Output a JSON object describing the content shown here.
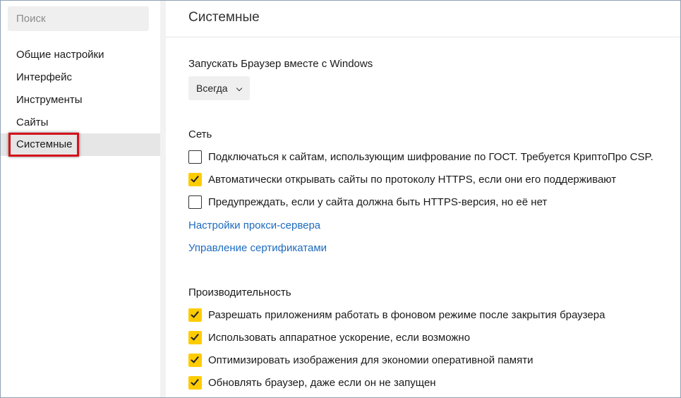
{
  "sidebar": {
    "search_placeholder": "Поиск",
    "items": [
      {
        "label": "Общие настройки"
      },
      {
        "label": "Интерфейс"
      },
      {
        "label": "Инструменты"
      },
      {
        "label": "Сайты"
      },
      {
        "label": "Системные",
        "active": true
      }
    ]
  },
  "main": {
    "title": "Системные",
    "startup": {
      "title": "Запускать Браузер вместе с Windows",
      "dropdown_value": "Всегда"
    },
    "network": {
      "title": "Сеть",
      "options": [
        {
          "label": "Подключаться к сайтам, использующим шифрование по ГОСТ. Требуется КриптоПро CSP.",
          "checked": false
        },
        {
          "label": "Автоматически открывать сайты по протоколу HTTPS, если они его поддерживают",
          "checked": true
        },
        {
          "label": "Предупреждать, если у сайта должна быть HTTPS-версия, но её нет",
          "checked": false
        }
      ],
      "links": [
        {
          "label": "Настройки прокси-сервера"
        },
        {
          "label": "Управление сертификатами"
        }
      ]
    },
    "performance": {
      "title": "Производительность",
      "options": [
        {
          "label": "Разрешать приложениям работать в фоновом режиме после закрытия браузера",
          "checked": true
        },
        {
          "label": "Использовать аппаратное ускорение, если возможно",
          "checked": true
        },
        {
          "label": "Оптимизировать изображения для экономии оперативной памяти",
          "checked": true
        },
        {
          "label": "Обновлять браузер, даже если он не запущен",
          "checked": true
        }
      ]
    }
  },
  "colors": {
    "accent_checkbox": "#ffcc00",
    "link": "#1d6bbf",
    "highlight_border": "#d4131c",
    "active_item_bg": "#e6e6e6"
  }
}
